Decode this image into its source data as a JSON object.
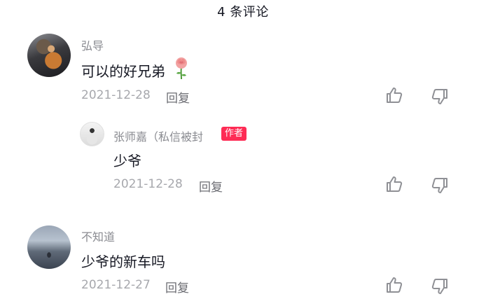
{
  "header": {
    "title": "4 条评论"
  },
  "comments": [
    {
      "author": "弘导",
      "text": "可以的好兄弟",
      "emoji": "rose-icon",
      "date": "2021-12-28",
      "reply_label": "回复",
      "replies": [
        {
          "author": "张师嘉（私信被封",
          "badge": "作者",
          "text": "少爷",
          "date": "2021-12-28",
          "reply_label": "回复"
        }
      ]
    },
    {
      "author": "不知道",
      "text": "少爷的新车吗",
      "date": "2021-12-27",
      "reply_label": "回复"
    }
  ],
  "icons": {
    "like": "thumbs-up-icon",
    "dislike": "thumbs-down-icon"
  },
  "colors": {
    "badge": "#fe2c55",
    "name": "#8a8b91",
    "text": "#161823",
    "date": "#a7a8ad"
  }
}
